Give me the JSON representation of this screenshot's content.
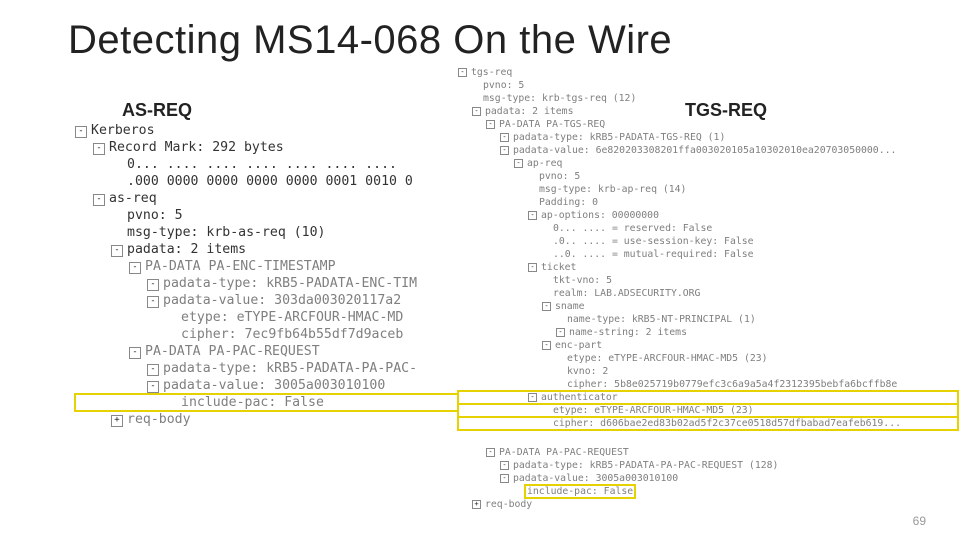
{
  "title": "Detecting MS14-068 On the Wire",
  "labels": {
    "as": "AS-REQ",
    "tgs": "TGS-REQ"
  },
  "page": "69",
  "left": [
    {
      "t": "m",
      "d": 0,
      "c": "dk",
      "x": "Kerberos"
    },
    {
      "t": "m",
      "d": 1,
      "c": "dk",
      "x": "Record Mark: 292 bytes"
    },
    {
      "t": "l",
      "d": 2,
      "c": "dk",
      "x": "0... .... .... .... .... .... ...."
    },
    {
      "t": "l",
      "d": 2,
      "c": "dk",
      "x": ".000 0000 0000 0000 0000 0001 0010 0"
    },
    {
      "t": "m",
      "d": 1,
      "c": "dk",
      "x": "as-req"
    },
    {
      "t": "l",
      "d": 2,
      "c": "dk",
      "x": "pvno: 5"
    },
    {
      "t": "l",
      "d": 2,
      "c": "dk",
      "x": "msg-type: krb-as-req (10)"
    },
    {
      "t": "m",
      "d": 2,
      "c": "dk",
      "x": "padata: 2 items"
    },
    {
      "t": "m",
      "d": 3,
      "c": "g",
      "x": "PA-DATA PA-ENC-TIMESTAMP"
    },
    {
      "t": "m",
      "d": 4,
      "c": "g",
      "x": "padata-type: kRB5-PADATA-ENC-TIM"
    },
    {
      "t": "m",
      "d": 4,
      "c": "g",
      "x": "padata-value: 303da003020117a2"
    },
    {
      "t": "l",
      "d": 5,
      "c": "g",
      "x": "etype: eTYPE-ARCFOUR-HMAC-MD"
    },
    {
      "t": "l",
      "d": 5,
      "c": "g",
      "x": "cipher: 7ec9fb64b55df7d9aceb"
    },
    {
      "t": "m",
      "d": 3,
      "c": "g",
      "x": "PA-DATA PA-PAC-REQUEST"
    },
    {
      "t": "m",
      "d": 4,
      "c": "g",
      "x": "padata-type: kRB5-PADATA-PA-PAC-"
    },
    {
      "t": "m",
      "d": 4,
      "c": "g",
      "x": "padata-value: 3005a003010100"
    },
    {
      "t": "l",
      "d": 5,
      "c": "g",
      "hl": true,
      "x": "include-pac: False"
    },
    {
      "t": "p",
      "d": 2,
      "c": "g",
      "x": "req-body"
    }
  ],
  "r1": [
    {
      "t": "m",
      "d": 0,
      "c": "g",
      "x": "tgs-req"
    },
    {
      "t": "l",
      "d": 1,
      "c": "g",
      "x": "pvno: 5"
    },
    {
      "t": "l",
      "d": 1,
      "c": "g",
      "x": "msg-type: krb-tgs-req (12)"
    },
    {
      "t": "m",
      "d": 1,
      "c": "g",
      "x": "padata: 2 items"
    },
    {
      "t": "m",
      "d": 2,
      "c": "g",
      "x": "PA-DATA PA-TGS-REQ"
    },
    {
      "t": "m",
      "d": 3,
      "c": "g",
      "x": "padata-type: kRB5-PADATA-TGS-REQ (1)"
    },
    {
      "t": "m",
      "d": 3,
      "c": "g",
      "x": "padata-value: 6e820203308201ffa003020105a10302010ea20703050000..."
    },
    {
      "t": "m",
      "d": 4,
      "c": "g",
      "x": "ap-req"
    },
    {
      "t": "l",
      "d": 5,
      "c": "g",
      "x": "pvno: 5"
    },
    {
      "t": "l",
      "d": 5,
      "c": "g",
      "x": "msg-type: krb-ap-req (14)"
    },
    {
      "t": "l",
      "d": 5,
      "c": "g",
      "x": "Padding: 0"
    },
    {
      "t": "m",
      "d": 5,
      "c": "g",
      "x": "ap-options: 00000000"
    },
    {
      "t": "l",
      "d": 6,
      "c": "g",
      "x": "0... .... = reserved: False"
    },
    {
      "t": "l",
      "d": 6,
      "c": "g",
      "x": ".0.. .... = use-session-key: False"
    },
    {
      "t": "l",
      "d": 6,
      "c": "g",
      "x": "..0. .... = mutual-required: False"
    },
    {
      "t": "m",
      "d": 5,
      "c": "g",
      "x": "ticket"
    },
    {
      "t": "l",
      "d": 6,
      "c": "g",
      "x": "tkt-vno: 5"
    },
    {
      "t": "l",
      "d": 6,
      "c": "g",
      "x": "realm: LAB.ADSECURITY.ORG"
    },
    {
      "t": "m",
      "d": 6,
      "c": "g",
      "x": "sname"
    },
    {
      "t": "l",
      "d": 7,
      "c": "g",
      "x": "name-type: kRB5-NT-PRINCIPAL (1)"
    },
    {
      "t": "m",
      "d": 7,
      "c": "g",
      "x": "name-string: 2 items"
    },
    {
      "t": "m",
      "d": 6,
      "c": "g",
      "x": "enc-part"
    },
    {
      "t": "l",
      "d": 7,
      "c": "g",
      "x": "etype: eTYPE-ARCFOUR-HMAC-MD5 (23)"
    },
    {
      "t": "l",
      "d": 7,
      "c": "g",
      "x": "kvno: 2"
    },
    {
      "t": "l",
      "d": 7,
      "c": "g",
      "x": "cipher: 5b8e025719b0779efc3c6a9a5a4f2312395bebfa6bcffb8e"
    },
    {
      "t": "m",
      "d": 5,
      "c": "g",
      "hl": true,
      "x": "authenticator"
    },
    {
      "t": "l",
      "d": 6,
      "c": "g",
      "hl": true,
      "x": "etype: eTYPE-ARCFOUR-HMAC-MD5 (23)"
    },
    {
      "t": "l",
      "d": 6,
      "c": "g",
      "hl": true,
      "x": "cipher: d606bae2ed83b02ad5f2c37ce0518d57dfbabad7eafeb619..."
    }
  ],
  "r2": [
    {
      "t": "m",
      "d": 2,
      "c": "g",
      "x": "PA-DATA PA-PAC-REQUEST"
    },
    {
      "t": "m",
      "d": 3,
      "c": "g",
      "x": "padata-type: kRB5-PADATA-PA-PAC-REQUEST (128)"
    },
    {
      "t": "m",
      "d": 3,
      "c": "g",
      "x": "padata-value: 3005a003010100"
    },
    {
      "t": "l",
      "d": 4,
      "c": "g",
      "hl2": true,
      "x": "include-pac: False"
    },
    {
      "t": "p",
      "d": 1,
      "c": "g",
      "x": "req-body"
    }
  ]
}
